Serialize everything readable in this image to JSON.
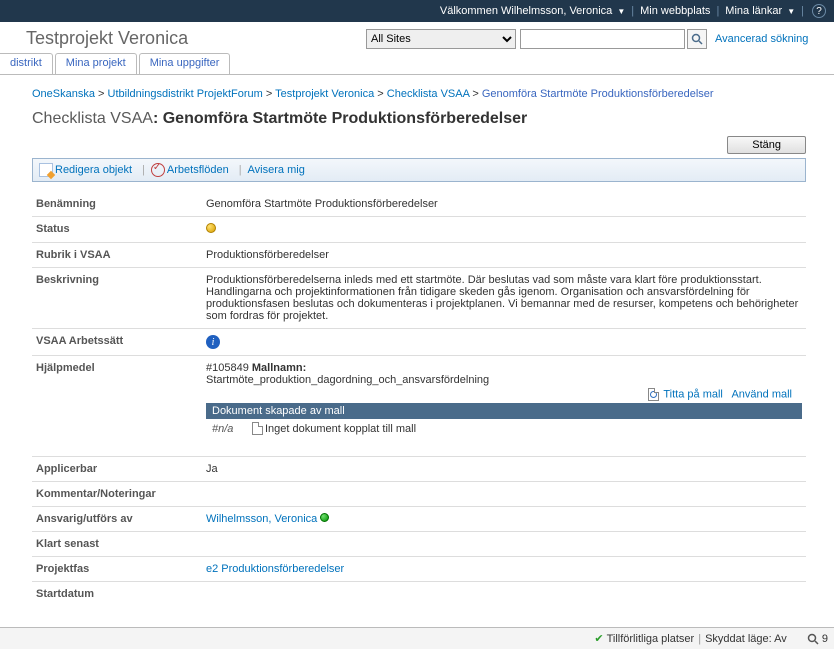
{
  "topbar": {
    "welcome": "Välkommen Wilhelmsson, Veronica",
    "mysite": "Min webbplats",
    "mylinks": "Mina länkar"
  },
  "header": {
    "title": "Testprojekt Veronica",
    "scope": "All Sites",
    "advanced": "Avancerad sökning"
  },
  "tabs": {
    "t1": "distrikt",
    "t2": "Mina projekt",
    "t3": "Mina uppgifter"
  },
  "breadcrumb": {
    "p1": "OneSkanska",
    "p2": "Utbildningsdistrikt ProjektForum",
    "p3": "Testprojekt Veronica",
    "p4": "Checklista VSAA",
    "current": "Genomföra Startmöte Produktionsförberedelser"
  },
  "pagetitle": {
    "prefix": "Checklista VSAA",
    "main": "Genomföra Startmöte Produktionsförberedelser"
  },
  "buttons": {
    "close": "Stäng"
  },
  "toolbar": {
    "edit": "Redigera objekt",
    "workflows": "Arbetsflöden",
    "alert": "Avisera mig"
  },
  "labels": {
    "benamning": "Benämning",
    "status": "Status",
    "rubrik": "Rubrik i VSAA",
    "beskrivning": "Beskrivning",
    "arbetssatt": "VSAA Arbetssätt",
    "hjalpmedel": "Hjälpmedel",
    "applicerbar": "Applicerbar",
    "kommentar": "Kommentar/Noteringar",
    "ansvarig": "Ansvarig/utförs av",
    "klart": "Klart senast",
    "projektfas": "Projektfas",
    "startdatum": "Startdatum"
  },
  "values": {
    "benamning": "Genomföra Startmöte Produktionsförberedelser",
    "rubrik": "Produktionsförberedelser",
    "beskrivning": "Produktionsförberedelserna inleds med ett startmöte. Där beslutas vad som måste vara klart före produktionsstart. Handlingarna och projektinformationen från tidigare skeden gås igenom. Organisation och ansvarsfördelning för produktionsfasen beslutas och dokumenteras i projektplanen. Vi bemannar med de resurser, kompetens och behörigheter som fordras för projektet.",
    "template_id": "#105849",
    "template_label": "Mallnamn:",
    "template_name": "Startmöte_produktion_dagordning_och_ansvarsfördelning",
    "view_template": "Titta på mall",
    "use_template": "Använd mall",
    "docs_header": "Dokument skapade av mall",
    "na": "#n/a",
    "no_doc": "Inget dokument kopplat till mall",
    "applicerbar": "Ja",
    "ansvarig": "Wilhelmsson, Veronica",
    "projektfas": "e2 Produktionsförberedelser"
  },
  "statusbar": {
    "trusted": "Tillförlitliga platser",
    "protected": "Skyddat läge: Av",
    "zoom": "9"
  }
}
